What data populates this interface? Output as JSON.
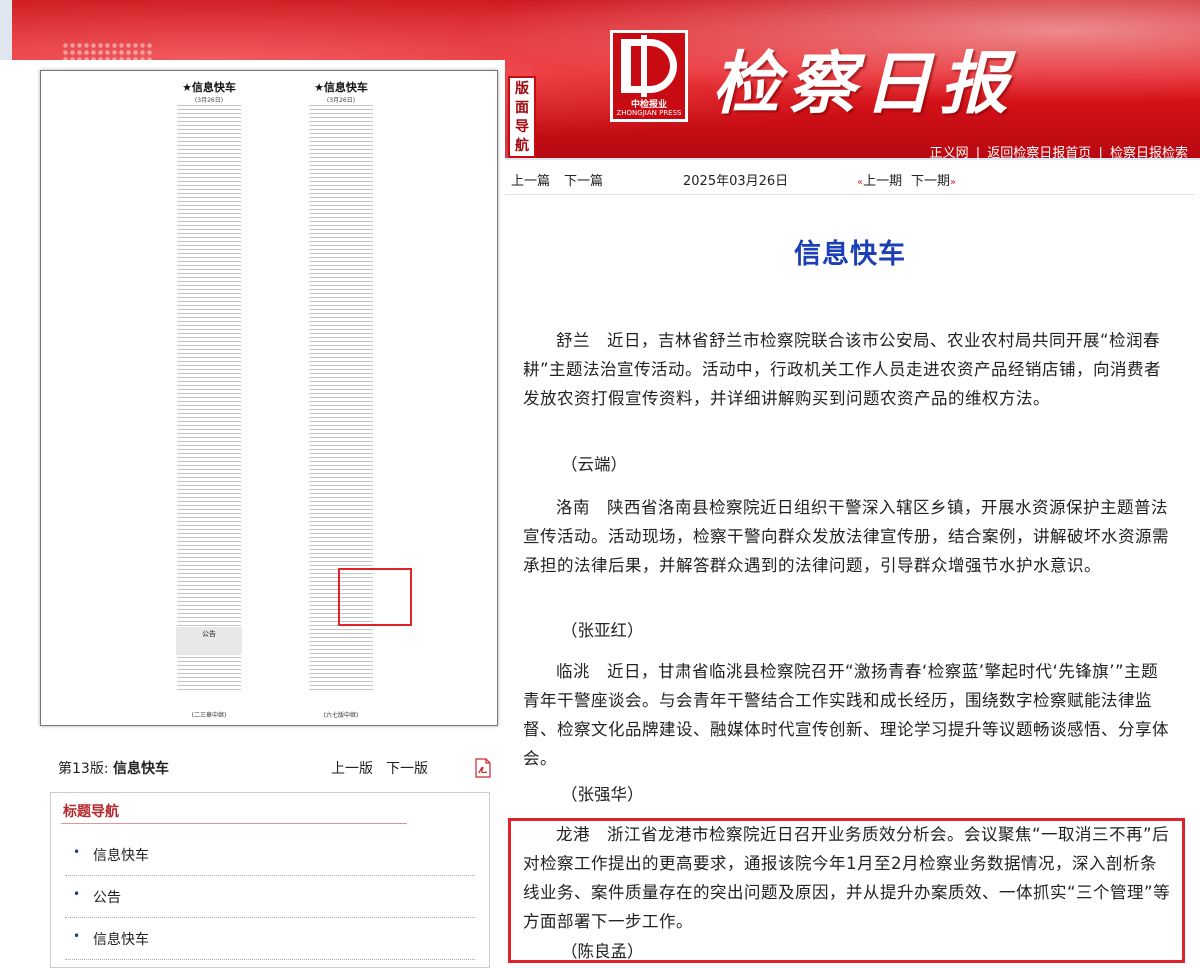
{
  "masthead": {
    "logo_cn": "中检报业",
    "logo_en": "ZHONGJIAN PRESS",
    "title": "检察日报",
    "nav_tag": "版面导航",
    "links": [
      "正义网",
      "返回检察日报首页",
      "检察日报检索"
    ]
  },
  "newspaper": {
    "col_a_title": "★信息快车",
    "col_a_date": "(3月26日)",
    "col_a_foot": "(二三章中继)",
    "col_b_title": "★信息快车",
    "col_b_date": "(3月26日)",
    "col_b_foot": "(六七版中继)",
    "notice": "公告"
  },
  "page_nav": {
    "page_no": "第13版:",
    "page_name": "信息快车",
    "prev": "上一版",
    "next": "下一版",
    "pdf_icon": "pdf-icon"
  },
  "title_nav": {
    "heading": "标题导航",
    "items": [
      "信息快车",
      "公告",
      "信息快车"
    ]
  },
  "article_nav": {
    "prev_article": "上一篇",
    "next_article": "下一篇",
    "date": "2025年03月26日",
    "prev_issue": "上一期",
    "next_issue": "下一期"
  },
  "article": {
    "title": "信息快车",
    "paragraphs": [
      "舒兰　近日，吉林省舒兰市检察院联合该市公安局、农业农村局共同开展“检润春耕”主题法治宣传活动。活动中，行政机关工作人员走进农资产品经销店铺，向消费者发放农资打假宣传资料，并详细讲解购买到问题农资产品的维权方法。",
      "洛南　陕西省洛南县检察院近日组织干警深入辖区乡镇，开展水资源保护主题普法宣传活动。活动现场，检察干警向群众发放法律宣传册，结合案例，讲解破坏水资源需承担的法律后果，并解答群众遇到的法律问题，引导群众增强节水护水意识。",
      "临洮　近日，甘肃省临洮县检察院召开“激扬青春‘检察蓝’擎起时代‘先锋旗’”主题青年干警座谈会。与会青年干警结合工作实践和成长经历，围绕数字检察赋能法律监督、检察文化品牌建设、融媒体时代宣传创新、理论学习提升等议题畅谈感悟、分享体会。",
      "龙港　浙江省龙港市检察院近日召开业务质效分析会。会议聚焦“一取消三不再”后对检察工作提出的更高要求，通报该院今年1月至2月检察业务数据情况，深入剖析条线业务、案件质量存在的突出问题及原因，并从提升办案质效、一体抓实“三个管理”等方面部署下一步工作。"
    ],
    "bylines": [
      "（云端）",
      "（张亚红）",
      "（张强华）",
      "（陈良孟）"
    ]
  }
}
